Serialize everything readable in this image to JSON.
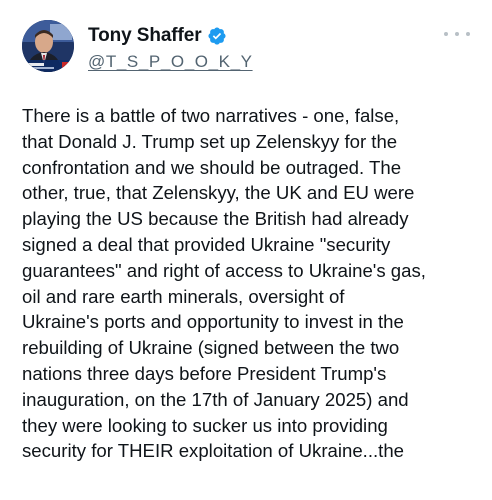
{
  "author": {
    "display_name": "Tony Shaffer",
    "handle": "@T_S_P_O_O_K_Y",
    "verified": true,
    "badge_color": "#1d9bf0"
  },
  "actions": {
    "more_icon": "more-horizontal-icon"
  },
  "post": {
    "text_lines": [
      "There is a battle of two narratives  - one, false,",
      "that Donald J. Trump set up Zelenskyy for the",
      "confrontation and we should be outraged. The",
      "other, true, that Zelenskyy, the UK and EU were",
      "playing the US because the British had already",
      "signed a deal that provided Ukraine \"security",
      "guarantees\" and right of access to Ukraine's gas,",
      "oil and rare earth minerals, oversight of",
      "Ukraine's ports and opportunity to invest in the",
      "rebuilding of Ukraine (signed between the two",
      "nations three days before President Trump's",
      "inauguration, on the 17th of January 2025) and",
      "they were looking to sucker us into providing",
      "security for THEIR exploitation of Ukraine...the"
    ]
  },
  "colors": {
    "text_primary": "#0f1419",
    "text_secondary": "#536471",
    "more_dots": "#b8c0c6"
  }
}
